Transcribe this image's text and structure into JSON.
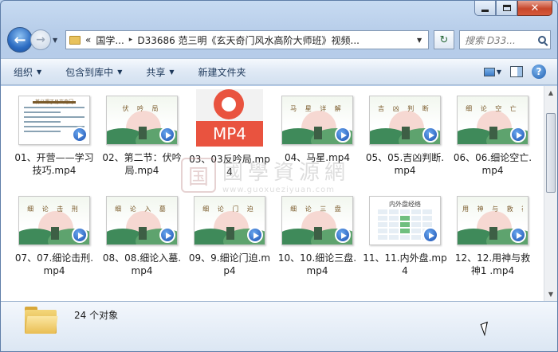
{
  "window": {
    "minimize_icon": "minimize-icon",
    "maximize_icon": "maximize-icon",
    "close_icon": "close-icon",
    "close_glyph": "✕"
  },
  "address": {
    "back_glyph": "←",
    "forward_glyph": "→",
    "history_glyph": "▼",
    "prefix": "«",
    "crumbs": [
      "国学...",
      "D33686 范三明《玄天奇门风水高阶大师班》视频..."
    ],
    "sep": "▸",
    "drop_glyph": "▼",
    "refresh_glyph": "↻",
    "search_placeholder": "搜索 D33..."
  },
  "toolbar": {
    "items": [
      "组织",
      "包含到库中",
      "共享",
      "新建文件夹"
    ],
    "dropdown_glyph": "▼",
    "help_glyph": "?"
  },
  "files": [
    {
      "name": "01、开营——学习技巧.mp4",
      "thumb": "doc",
      "title": "首义课丁易玄奇门"
    },
    {
      "name": "02、第二节：伏吟局.mp4",
      "thumb": "scene",
      "title": "伏 吟 局"
    },
    {
      "name": "03、03反吟局.mp4",
      "thumb": "mp4",
      "title": "MP4"
    },
    {
      "name": "04、马星.mp4",
      "thumb": "scene",
      "title": "马 星 详 解"
    },
    {
      "name": "05、05.吉凶判断.mp4",
      "thumb": "scene",
      "title": "吉 凶 判 断"
    },
    {
      "name": "06、06.细论空亡.mp4",
      "thumb": "scene",
      "title": "细 论 空 亡"
    },
    {
      "name": "07、07.细论击刑.mp4",
      "thumb": "scene",
      "title": "细 论 击 刑"
    },
    {
      "name": "08、08.细论入墓.mp4",
      "thumb": "scene",
      "title": "细 论 入 墓"
    },
    {
      "name": "09、9.细论门迫.mp4",
      "thumb": "scene",
      "title": "细 论 门 迫"
    },
    {
      "name": "10、10.细论三盘.mp4",
      "thumb": "scene",
      "title": "细 论 三 盘"
    },
    {
      "name": "11、11.内外盘.mp4",
      "thumb": "table",
      "title": "内外盘经络"
    },
    {
      "name": "12、12.用神与救神1 .mp4",
      "thumb": "scene",
      "title": "用 神 与 救 神"
    }
  ],
  "watermark": {
    "seal": "国",
    "cn": "國學資源網",
    "url": "www.guoxueziyuan.com"
  },
  "status": {
    "count": "24 个对象"
  },
  "scrollbar": {
    "up_glyph": "▲",
    "down_glyph": "▼",
    "position": 0.0
  }
}
